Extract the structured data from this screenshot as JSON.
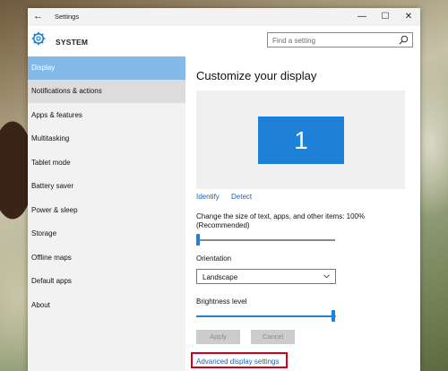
{
  "window": {
    "title": "Settings",
    "back_icon": "back-arrow-icon",
    "controls": {
      "minimize": "—",
      "maximize": "☐",
      "close": "✕"
    }
  },
  "header": {
    "section": "SYSTEM",
    "icon": "gear-icon",
    "search_placeholder": "Find a setting",
    "search_icon": "search-icon"
  },
  "sidebar": {
    "items": [
      {
        "label": "Display",
        "state": "selected"
      },
      {
        "label": "Notifications & actions",
        "state": "hover"
      },
      {
        "label": "Apps & features",
        "state": "normal"
      },
      {
        "label": "Multitasking",
        "state": "normal"
      },
      {
        "label": "Tablet mode",
        "state": "normal"
      },
      {
        "label": "Battery saver",
        "state": "normal"
      },
      {
        "label": "Power & sleep",
        "state": "normal"
      },
      {
        "label": "Storage",
        "state": "normal"
      },
      {
        "label": "Offline maps",
        "state": "normal"
      },
      {
        "label": "Default apps",
        "state": "normal"
      },
      {
        "label": "About",
        "state": "normal"
      }
    ]
  },
  "content": {
    "title": "Customize your display",
    "monitor_number": "1",
    "identify": "Identify",
    "detect": "Detect",
    "size_label": "Change the size of text, apps, and other items: 100% (Recommended)",
    "size_slider_value": 0,
    "orientation_label": "Orientation",
    "orientation_value": "Landscape",
    "brightness_label": "Brightness level",
    "brightness_value": 1.0,
    "apply": "Apply",
    "cancel": "Cancel",
    "advanced": "Advanced display settings"
  },
  "colors": {
    "accent": "#1f81d6",
    "selected_nav": "#82b9e9",
    "highlight_box": "#d1001c",
    "link": "#1466b8"
  }
}
